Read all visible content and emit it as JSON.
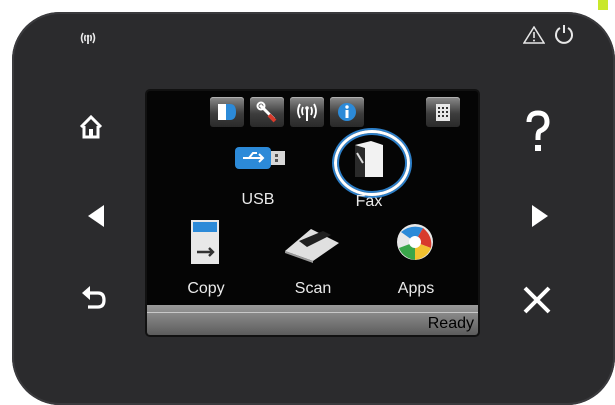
{
  "screen": {
    "apps": [
      {
        "label": "USB",
        "icon": "usb-icon"
      },
      {
        "label": "Fax",
        "icon": "fax-icon"
      },
      {
        "label": "Copy",
        "icon": "copy-icon"
      },
      {
        "label": "Scan",
        "icon": "scan-icon"
      },
      {
        "label": "Apps",
        "icon": "apps-icon"
      }
    ],
    "status": "Ready",
    "topbar_icons": [
      "supplies-icon",
      "setup-icon",
      "wireless-icon",
      "info-icon",
      "fax-log-icon"
    ],
    "selected_app": "Fax"
  },
  "panel": {
    "left_buttons": [
      "home-icon",
      "back-arrow-icon",
      "return-icon"
    ],
    "right_buttons": [
      "help-icon",
      "forward-arrow-icon",
      "cancel-icon"
    ],
    "indicators": [
      "wireless-led-icon",
      "warning-icon",
      "power-icon"
    ]
  },
  "colors": {
    "panel": "#2b2b2d",
    "screen": "#050505",
    "accent_blue": "#2d7fc8",
    "sticker": "#c9e82a"
  }
}
